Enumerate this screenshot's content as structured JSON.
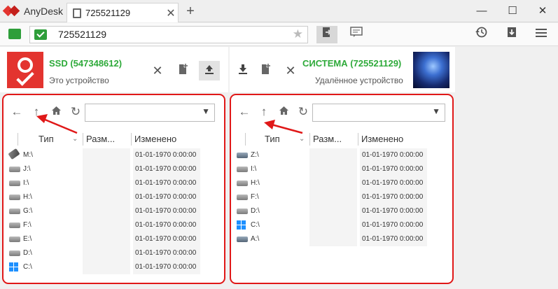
{
  "app": {
    "name": "AnyDesk",
    "tab_title": "725521129",
    "new_tab": "+",
    "tab_close": "✕"
  },
  "window_controls": {
    "minimize": "—",
    "maximize": "☐",
    "close": "✕"
  },
  "address": {
    "value": "725521129"
  },
  "toolbar": {
    "file_transfer_icon": "file-transfer-icon",
    "chat_icon": "chat-icon",
    "history_icon": "history-icon",
    "download_icon": "download-icon",
    "menu_icon": "menu-icon"
  },
  "local": {
    "name": "SSD (547348612)",
    "subtitle": "Это устройство",
    "path": "",
    "columns": {
      "type": "Тип",
      "size": "Разм...",
      "modified": "Изменено"
    },
    "drives": [
      {
        "name": "M:\\",
        "kind": "usb",
        "modified": "01-01-1970 0:00:00"
      },
      {
        "name": "J:\\",
        "kind": "hdd",
        "modified": "01-01-1970 0:00:00"
      },
      {
        "name": "I:\\",
        "kind": "hdd",
        "modified": "01-01-1970 0:00:00"
      },
      {
        "name": "H:\\",
        "kind": "hdd",
        "modified": "01-01-1970 0:00:00"
      },
      {
        "name": "G:\\",
        "kind": "hdd",
        "modified": "01-01-1970 0:00:00"
      },
      {
        "name": "F:\\",
        "kind": "hdd",
        "modified": "01-01-1970 0:00:00"
      },
      {
        "name": "E:\\",
        "kind": "hdd",
        "modified": "01-01-1970 0:00:00"
      },
      {
        "name": "D:\\",
        "kind": "hdd",
        "modified": "01-01-1970 0:00:00"
      },
      {
        "name": "C:\\",
        "kind": "win",
        "modified": "01-01-1970 0:00:00"
      }
    ]
  },
  "remote": {
    "name": "СИСТЕМА (725521129)",
    "subtitle": "Удалённое устройство",
    "path": "",
    "columns": {
      "type": "Тип",
      "size": "Разм...",
      "modified": "Изменено"
    },
    "drives": [
      {
        "name": "Z:\\",
        "kind": "net",
        "modified": "01-01-1970 0:00:00"
      },
      {
        "name": "I:\\",
        "kind": "hdd",
        "modified": "01-01-1970 0:00:00"
      },
      {
        "name": "H:\\",
        "kind": "hdd",
        "modified": "01-01-1970 0:00:00"
      },
      {
        "name": "F:\\",
        "kind": "hdd",
        "modified": "01-01-1970 0:00:00"
      },
      {
        "name": "D:\\",
        "kind": "hdd",
        "modified": "01-01-1970 0:00:00"
      },
      {
        "name": "C:\\",
        "kind": "win",
        "modified": "01-01-1970 0:00:00"
      },
      {
        "name": "A:\\",
        "kind": "net",
        "modified": "01-01-1970 0:00:00"
      }
    ]
  },
  "colors": {
    "accent_green": "#2eaa3a",
    "brand_red": "#e3342f",
    "highlight_red": "#e01818"
  }
}
